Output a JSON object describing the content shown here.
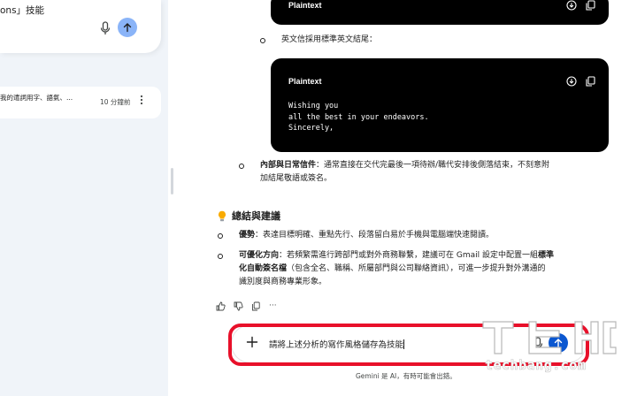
{
  "sidebar": {
    "card_text_tail": "ons」技能",
    "recent": {
      "title": "我的遣詞用字、語氣、...",
      "time": "10 分鐘前"
    }
  },
  "chat": {
    "code_blocks": [
      {
        "lang": "Plaintext",
        "lines": []
      },
      {
        "lang": "Plaintext",
        "lines": [
          "Wishing you",
          "all the best in your endeavors.",
          "Sincerely,"
        ]
      }
    ],
    "bullet_english": "英文信採用標準英文結尾：",
    "internal_label": "內部與日常信件",
    "internal_text_1": "：通常直接在交代完最後一項待辦/職代安排後側落結束，不刻意附",
    "internal_text_2": "加結尾敬語或簽名。",
    "summary_heading": "總結與建議",
    "advantage_label": "優勢",
    "advantage_text": "：表達目標明確、重點先行、段落留白易於手機與電腦端快速閱讀。",
    "opt_label": "可優化方向",
    "opt_text_1a": "：若頻繁需進行跨部門或對外商務聯繫，建議可在 Gmail 設定中配置一組",
    "opt_bold_1": "標準",
    "opt_bold_2": "化自動簽名檔",
    "opt_text_2": "（包含全名、職稱、所屬部門與公司聯絡資訊），可進一步提升對外溝通的",
    "opt_text_3": "識別度與商務專業形象。",
    "actions_more": "···"
  },
  "input": {
    "value": "請將上述分析的寫作風格儲存為技能"
  },
  "disclaimer": "Gemini 是 AI，有時可能會出錯。",
  "watermark": {
    "text": "techbang.com"
  },
  "colors": {
    "highlight": "#e8102a",
    "send_active": "#0b57d0",
    "send_inactive": "#8ab4f8",
    "sidebar_bg": "#f0f4f9",
    "code_bg": "#000000"
  }
}
